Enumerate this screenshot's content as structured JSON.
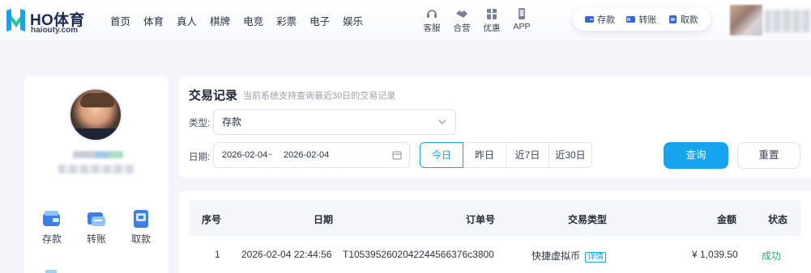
{
  "header": {
    "logo_title": "HO体育",
    "logo_sub": "haiouty.com",
    "nav": [
      "首页",
      "体育",
      "真人",
      "棋牌",
      "电竞",
      "彩票",
      "电子",
      "娱乐"
    ],
    "quick": [
      {
        "label": "客服",
        "icon": "headset-icon"
      },
      {
        "label": "合营",
        "icon": "handshake-icon"
      },
      {
        "label": "优惠",
        "icon": "gift-icon"
      },
      {
        "label": "APP",
        "icon": "phone-icon"
      }
    ],
    "wallet_pill": [
      {
        "label": "存款",
        "icon": "deposit-icon"
      },
      {
        "label": "转账",
        "icon": "transfer-icon"
      },
      {
        "label": "取款",
        "icon": "withdraw-icon"
      }
    ]
  },
  "sidebar": {
    "actions": [
      {
        "label": "存款",
        "icon": "deposit-icon"
      },
      {
        "label": "转账",
        "icon": "transfer-icon"
      },
      {
        "label": "取款",
        "icon": "withdraw-icon"
      }
    ]
  },
  "filter": {
    "title": "交易记录",
    "tip": "当前系统支持查询最近30日的交易记录",
    "type_label": "类型:",
    "type_value": "存款",
    "date_label": "日期:",
    "date_start": "2026-02-04",
    "date_sep": "~",
    "date_end": "2026-02-04",
    "ranges": [
      "今日",
      "昨日",
      "近7日",
      "近30日"
    ],
    "active_range": "今日",
    "query_label": "查询",
    "reset_label": "重置"
  },
  "table": {
    "columns": [
      "序号",
      "日期",
      "订单号",
      "交易类型",
      "金额",
      "状态"
    ],
    "rows": [
      {
        "index": "1",
        "date": "2026-02-04 22:44:56",
        "order": "T10539526020422445663​76c3800",
        "type": "快捷虚拟币",
        "detail": "详情",
        "amount": "¥ 1,039.50",
        "status": "成功"
      }
    ]
  },
  "colors": {
    "accent": "#17a3ee",
    "success": "#2aae6a",
    "background": "#f3f5fb"
  }
}
